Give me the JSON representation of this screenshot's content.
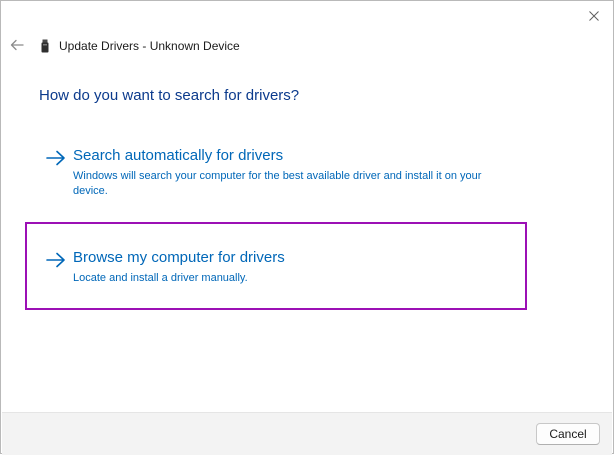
{
  "window": {
    "title": "Update Drivers - Unknown Device",
    "back_icon": "back-arrow-icon",
    "close_icon": "close-icon",
    "device_icon": "usb-device-icon"
  },
  "main": {
    "question": "How do you want to search for drivers?",
    "options": [
      {
        "title": "Search automatically for drivers",
        "description": "Windows will search your computer for the best available driver and install it on your device.",
        "icon": "right-arrow-icon"
      },
      {
        "title": "Browse my computer for drivers",
        "description": "Locate and install a driver manually.",
        "icon": "right-arrow-icon",
        "highlighted": true
      }
    ]
  },
  "footer": {
    "cancel_label": "Cancel"
  },
  "colors": {
    "link": "#0067b8",
    "heading": "#0b3a8c",
    "highlight": "#9c10b5",
    "footer_bg": "#f3f3f3"
  }
}
